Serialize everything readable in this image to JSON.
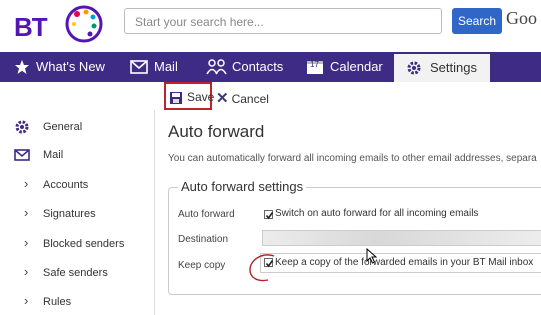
{
  "header": {
    "logo_text": "BT",
    "search_placeholder": "Start your search here...",
    "search_button": "Search",
    "google_fragment": "Goo"
  },
  "nav": {
    "items": [
      {
        "label": "What's New",
        "icon": "star-icon"
      },
      {
        "label": "Mail",
        "icon": "envelope-icon"
      },
      {
        "label": "Contacts",
        "icon": "people-icon"
      },
      {
        "label": "Calendar",
        "icon": "calendar-icon",
        "icon_text": "17"
      },
      {
        "label": "Settings",
        "icon": "gear-icon",
        "active": true
      }
    ]
  },
  "toolbar": {
    "save_label": "Save",
    "cancel_label": "Cancel"
  },
  "sidebar": {
    "items": [
      {
        "label": "General",
        "icon": "gear-icon"
      },
      {
        "label": "Mail",
        "icon": "envelope-icon"
      },
      {
        "label": "Accounts",
        "icon": "chevron-right-icon"
      },
      {
        "label": "Signatures",
        "icon": "chevron-right-icon"
      },
      {
        "label": "Blocked senders",
        "icon": "chevron-right-icon"
      },
      {
        "label": "Safe senders",
        "icon": "chevron-right-icon"
      },
      {
        "label": "Rules",
        "icon": "chevron-right-icon"
      }
    ]
  },
  "main": {
    "title": "Auto forward",
    "description": "You can automatically forward all incoming emails to other email addresses, separa",
    "section_title": "Auto forward settings",
    "auto_forward_label": "Auto forward",
    "auto_forward_text": "Switch on auto forward for all incoming emails",
    "auto_forward_checked": true,
    "destination_label": "Destination",
    "destination_value": "",
    "keep_copy_label": "Keep copy",
    "keep_copy_text": "Keep a copy of the forwarded emails in your BT Mail inbox",
    "keep_copy_checked": true
  },
  "colors": {
    "brand_purple": "#5514b4",
    "nav_bg": "#3d2b85",
    "search_button": "#2f66c8",
    "highlight_red": "#c0222a"
  }
}
